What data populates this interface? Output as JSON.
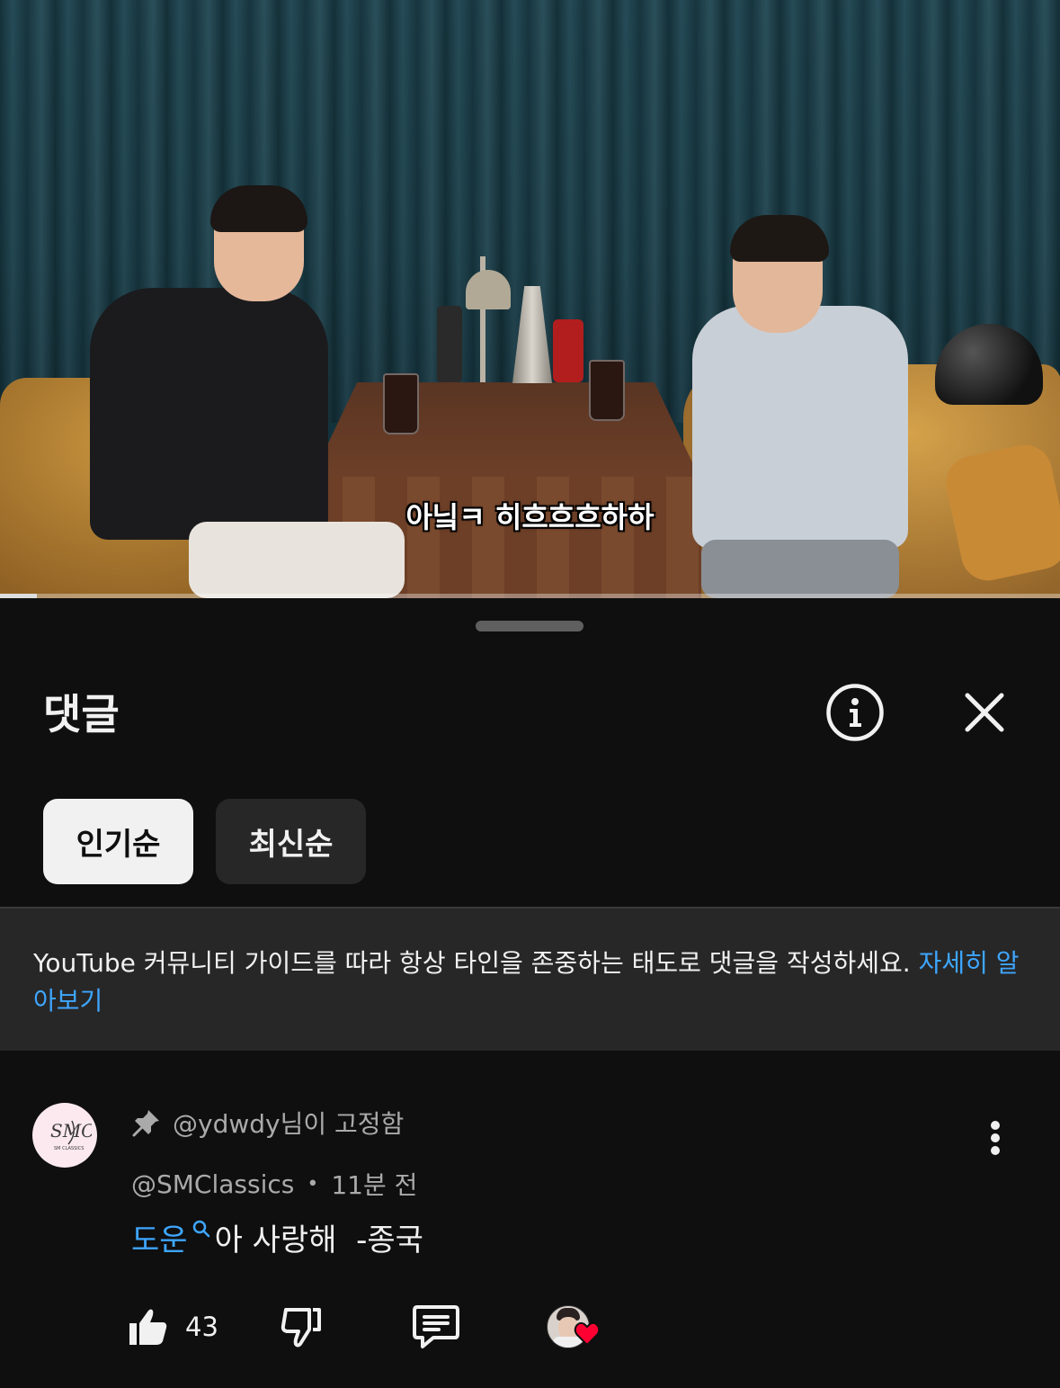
{
  "video": {
    "subtitle": "아닠ㅋ 히흐흐흐하하",
    "progress_fraction": 0.035
  },
  "comments_panel": {
    "title": "댓글",
    "sort_chips": [
      {
        "label": "인기순",
        "selected": true
      },
      {
        "label": "최신순",
        "selected": false
      }
    ],
    "guidelines": {
      "text": "YouTube 커뮤니티 가이드를 따라 항상 타인을 존중하는 태도로 댓글을 작성하세요. ",
      "link": "자세히 알아보기"
    },
    "comment": {
      "pinned_label": "@ydwdy님이 고정함",
      "author": "@SMClassics",
      "separator": "•",
      "time": "11분 전",
      "mention": "도운",
      "body": "아 사랑해  -종국",
      "like_count": "43",
      "avatar_text": "SMC",
      "avatar_subtext": "SM CLASSICS"
    }
  },
  "colors": {
    "background": "#0f0f0f",
    "surface": "#272727",
    "text_primary": "#f1f1f1",
    "text_secondary": "#aaaaaa",
    "link": "#3ea6ff",
    "heart": "#ff0033"
  },
  "icons": [
    "info-icon",
    "close-icon",
    "pin-icon",
    "search-icon",
    "more-vert-icon",
    "thumb-up-icon",
    "thumb-down-icon",
    "reply-icon",
    "heart-icon"
  ]
}
